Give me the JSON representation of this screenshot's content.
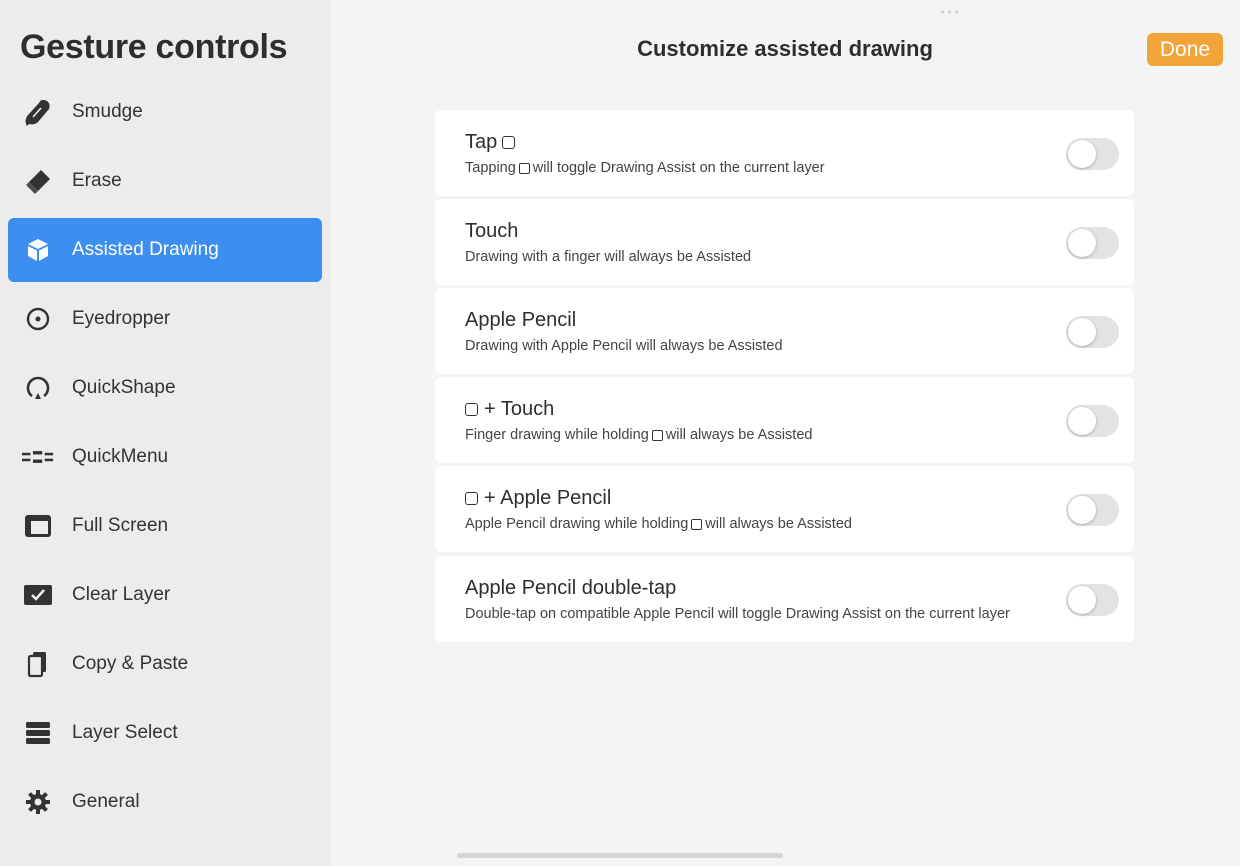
{
  "sidebar": {
    "title": "Gesture controls",
    "items": [
      {
        "label": "Smudge",
        "icon": "smudge-icon"
      },
      {
        "label": "Erase",
        "icon": "eraser-icon"
      },
      {
        "label": "Assisted Drawing",
        "icon": "cube-icon",
        "active": true
      },
      {
        "label": "Eyedropper",
        "icon": "eyedropper-icon"
      },
      {
        "label": "QuickShape",
        "icon": "quickshape-icon"
      },
      {
        "label": "QuickMenu",
        "icon": "quickmenu-icon"
      },
      {
        "label": "Full Screen",
        "icon": "fullscreen-icon"
      },
      {
        "label": "Clear Layer",
        "icon": "checkbox-icon"
      },
      {
        "label": "Copy & Paste",
        "icon": "copy-icon"
      },
      {
        "label": "Layer Select",
        "icon": "layers-icon"
      },
      {
        "label": "General",
        "icon": "gear-icon"
      }
    ]
  },
  "header": {
    "title": "Customize assisted drawing",
    "done_label": "Done"
  },
  "options": [
    {
      "title": "Tap",
      "title_parts": [
        "Tap"
      ],
      "desc_parts": [
        "Tapping",
        "will toggle Drawing Assist on the current layer"
      ],
      "enabled": false
    },
    {
      "title": "Touch",
      "desc": "Drawing with a finger will always be Assisted",
      "enabled": false
    },
    {
      "title": "Apple Pencil",
      "desc": "Drawing with Apple Pencil will always be Assisted",
      "enabled": false
    },
    {
      "title_suffix": "+ Touch",
      "desc_parts": [
        "Finger drawing while holding",
        "will always be Assisted"
      ],
      "enabled": false
    },
    {
      "title_suffix": "+ Apple Pencil",
      "desc_parts": [
        "Apple Pencil drawing while holding",
        "will always be Assisted"
      ],
      "enabled": false
    },
    {
      "title": "Apple Pencil double-tap",
      "desc": "Double-tap on compatible Apple Pencil will toggle Drawing Assist on the current layer",
      "enabled": false
    }
  ],
  "colors": {
    "accent": "#3c8ef0",
    "done": "#f0a43a",
    "toggle_off": "#e3e3e3"
  }
}
